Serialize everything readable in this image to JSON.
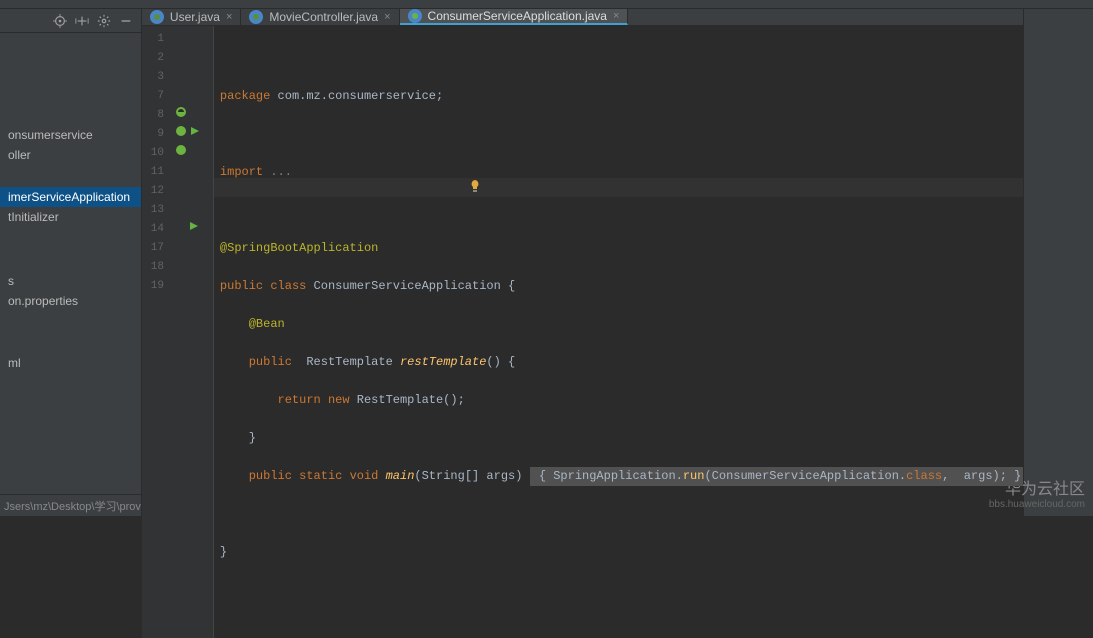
{
  "sidebar": {
    "items": [
      {
        "label": "onsumerservice",
        "selected": false
      },
      {
        "label": "oller",
        "selected": false
      },
      {
        "label": "imerServiceApplication",
        "selected": true
      },
      {
        "label": "tInitializer",
        "selected": false
      },
      {
        "label": "s",
        "selected": false
      },
      {
        "label": "on.properties",
        "selected": false
      },
      {
        "label": "ml",
        "selected": false
      }
    ],
    "status": "Jsers\\mz\\Desktop\\学习\\prov"
  },
  "tabs": [
    {
      "label": "User.java",
      "active": false
    },
    {
      "label": "MovieController.java",
      "active": false
    },
    {
      "label": "ConsumerServiceApplication.java",
      "active": true
    }
  ],
  "code": {
    "lines": [
      1,
      2,
      3,
      7,
      8,
      9,
      10,
      11,
      12,
      13,
      14,
      17,
      18,
      19
    ],
    "l1_kw": "package",
    "l1_rest": " com.mz.consumerservice;",
    "l3_kw": "import",
    "l3_rest": " ...",
    "l8": "@SpringBootApplication",
    "l9_pub": "public ",
    "l9_cls": "class",
    "l9_name": " ConsumerServiceApplication ",
    "l9_b": "{",
    "l10": "@Bean",
    "l11_pub": "public",
    "l11_sp": "  RestTemplate ",
    "l11_fn": "restTemplate",
    "l11_end": "() {",
    "l12_ret": "return ",
    "l12_new": "new",
    "l12_rest": " RestTemplate();",
    "l13": "}",
    "l14_pub": "public ",
    "l14_st": "static ",
    "l14_vd": "void ",
    "l14_main": "main",
    "l14_arg": "(String[] args) ",
    "l14_b1": " { SpringApplication.",
    "l14_run": "run",
    "l14_b2": "(ConsumerServiceApplication.",
    "l14_cls": "class",
    "l14_b3": ",  args);",
    "l14_b4": " }",
    "l18": "}"
  },
  "watermark": {
    "title": "华为云社区",
    "sub": "bbs.huaweicloud.com"
  }
}
